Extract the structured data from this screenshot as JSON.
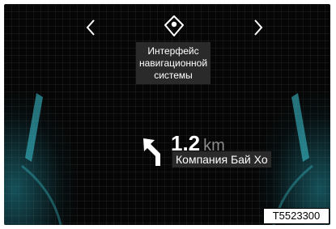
{
  "screen": {
    "caption": "Интерфейс навигационной системы",
    "nav": {
      "prev_icon": "chevron-left-icon",
      "next_icon": "chevron-right-icon",
      "center_icon": "map-pin-icon"
    },
    "guidance": {
      "turn_icon": "turn-left-arrow-icon",
      "distance_value": "1.2",
      "distance_unit": "km",
      "street_name": "Компания Бай Хо"
    }
  },
  "figure_code": "T5523300",
  "colors": {
    "background": "#060606",
    "accent_glow": "#28aabe",
    "label_bg": "#2a2a2a",
    "unit_gray": "#8c8c8c"
  }
}
